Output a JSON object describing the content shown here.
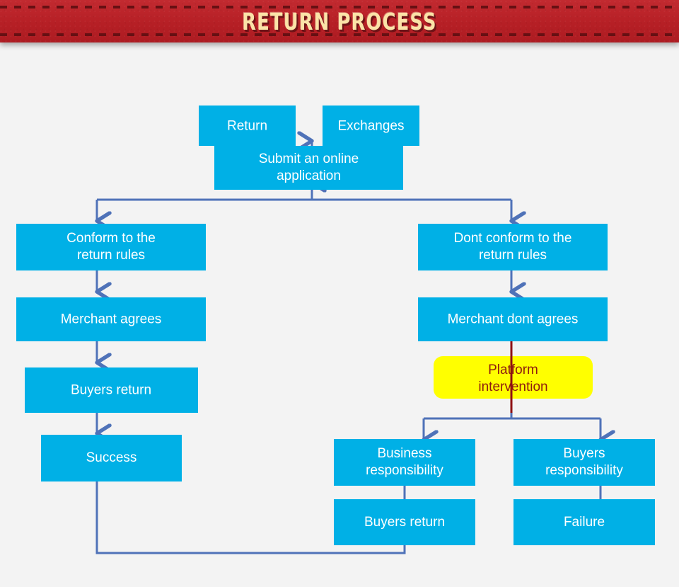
{
  "header": {
    "title": "RETURN PROCESS",
    "background_color": "#bf2229",
    "title_color": "#fbe3a8"
  },
  "theme": {
    "page_background": "#f3f3f3",
    "node_fill": "#00b0e6",
    "node_text": "#ffffff",
    "accent_node_fill": "#ffff00",
    "accent_node_text": "#8d1b10",
    "connector_color": "#4f72b8",
    "accent_connector_color": "#8e1013"
  },
  "flowchart": {
    "type": "flowchart",
    "nodes": [
      {
        "id": "return",
        "label": "Return",
        "lines": [
          "Return"
        ],
        "style": "primary"
      },
      {
        "id": "exchanges",
        "label": "Exchanges",
        "lines": [
          "Exchanges"
        ],
        "style": "primary"
      },
      {
        "id": "submit",
        "label": "Submit an online application",
        "lines": [
          "Submit an online",
          "application"
        ],
        "style": "primary"
      },
      {
        "id": "conform",
        "label": "Conform to the return rules",
        "lines": [
          "Conform to the",
          "return rules"
        ],
        "style": "primary"
      },
      {
        "id": "dont_conform",
        "label": "Dont conform to the return rules",
        "lines": [
          "Dont conform to the",
          "return rules"
        ],
        "style": "primary"
      },
      {
        "id": "merchant_agrees",
        "label": "Merchant agrees",
        "lines": [
          "Merchant agrees"
        ],
        "style": "primary"
      },
      {
        "id": "merchant_dont",
        "label": "Merchant dont agrees",
        "lines": [
          "Merchant dont agrees"
        ],
        "style": "primary"
      },
      {
        "id": "buyers_return_left",
        "label": "Buyers return",
        "lines": [
          "Buyers return"
        ],
        "style": "primary"
      },
      {
        "id": "platform",
        "label": "Platform intervention",
        "lines": [
          "Platform",
          "intervention"
        ],
        "style": "accent"
      },
      {
        "id": "success",
        "label": "Success",
        "lines": [
          "Success"
        ],
        "style": "primary"
      },
      {
        "id": "business_resp",
        "label": "Business responsibility",
        "lines": [
          "Business",
          "responsibility"
        ],
        "style": "primary"
      },
      {
        "id": "buyers_resp",
        "label": "Buyers responsibility",
        "lines": [
          "Buyers",
          "responsibility"
        ],
        "style": "primary"
      },
      {
        "id": "buyers_return_bottom",
        "label": "Buyers return",
        "lines": [
          "Buyers return"
        ],
        "style": "primary"
      },
      {
        "id": "failure",
        "label": "Failure",
        "lines": [
          "Failure"
        ],
        "style": "primary"
      }
    ],
    "edges": [
      {
        "from": "return",
        "to": "submit"
      },
      {
        "from": "exchanges",
        "to": "submit"
      },
      {
        "from": "submit",
        "to": "conform"
      },
      {
        "from": "submit",
        "to": "dont_conform"
      },
      {
        "from": "conform",
        "to": "merchant_agrees"
      },
      {
        "from": "merchant_agrees",
        "to": "buyers_return_left"
      },
      {
        "from": "buyers_return_left",
        "to": "success"
      },
      {
        "from": "dont_conform",
        "to": "merchant_dont"
      },
      {
        "from": "merchant_dont",
        "to": "platform"
      },
      {
        "from": "platform",
        "to": "business_resp"
      },
      {
        "from": "platform",
        "to": "buyers_resp"
      },
      {
        "from": "business_resp",
        "to": "buyers_return_bottom"
      },
      {
        "from": "buyers_resp",
        "to": "failure"
      },
      {
        "from": "buyers_return_bottom",
        "to": "success"
      }
    ]
  }
}
